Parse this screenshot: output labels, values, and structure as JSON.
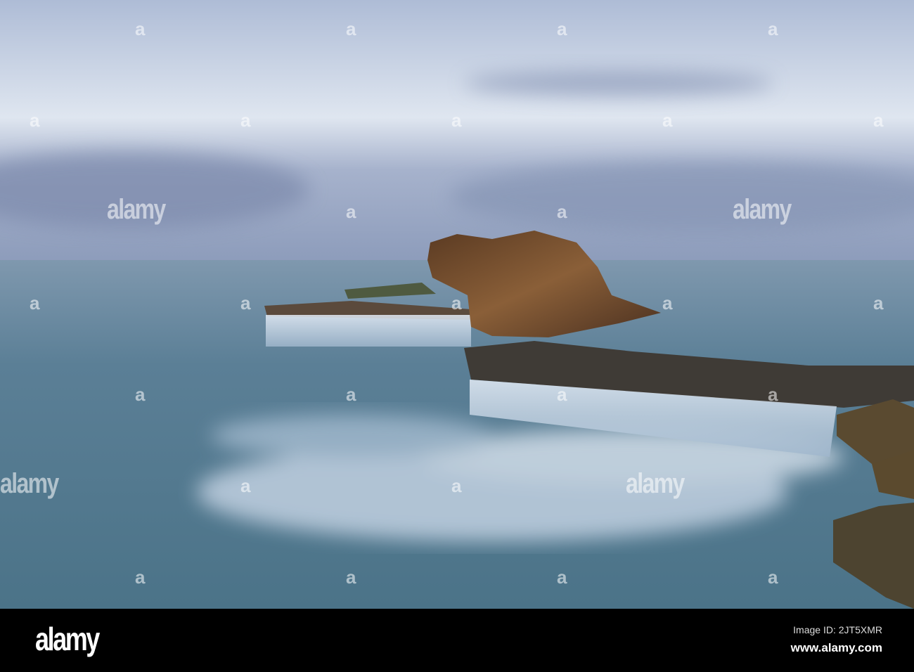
{
  "watermark": {
    "text": "alamy",
    "mark": "a"
  },
  "footer": {
    "logo": "alamy",
    "image_id": "Image ID: 2JT5XMR",
    "website": "www.alamy.com"
  }
}
